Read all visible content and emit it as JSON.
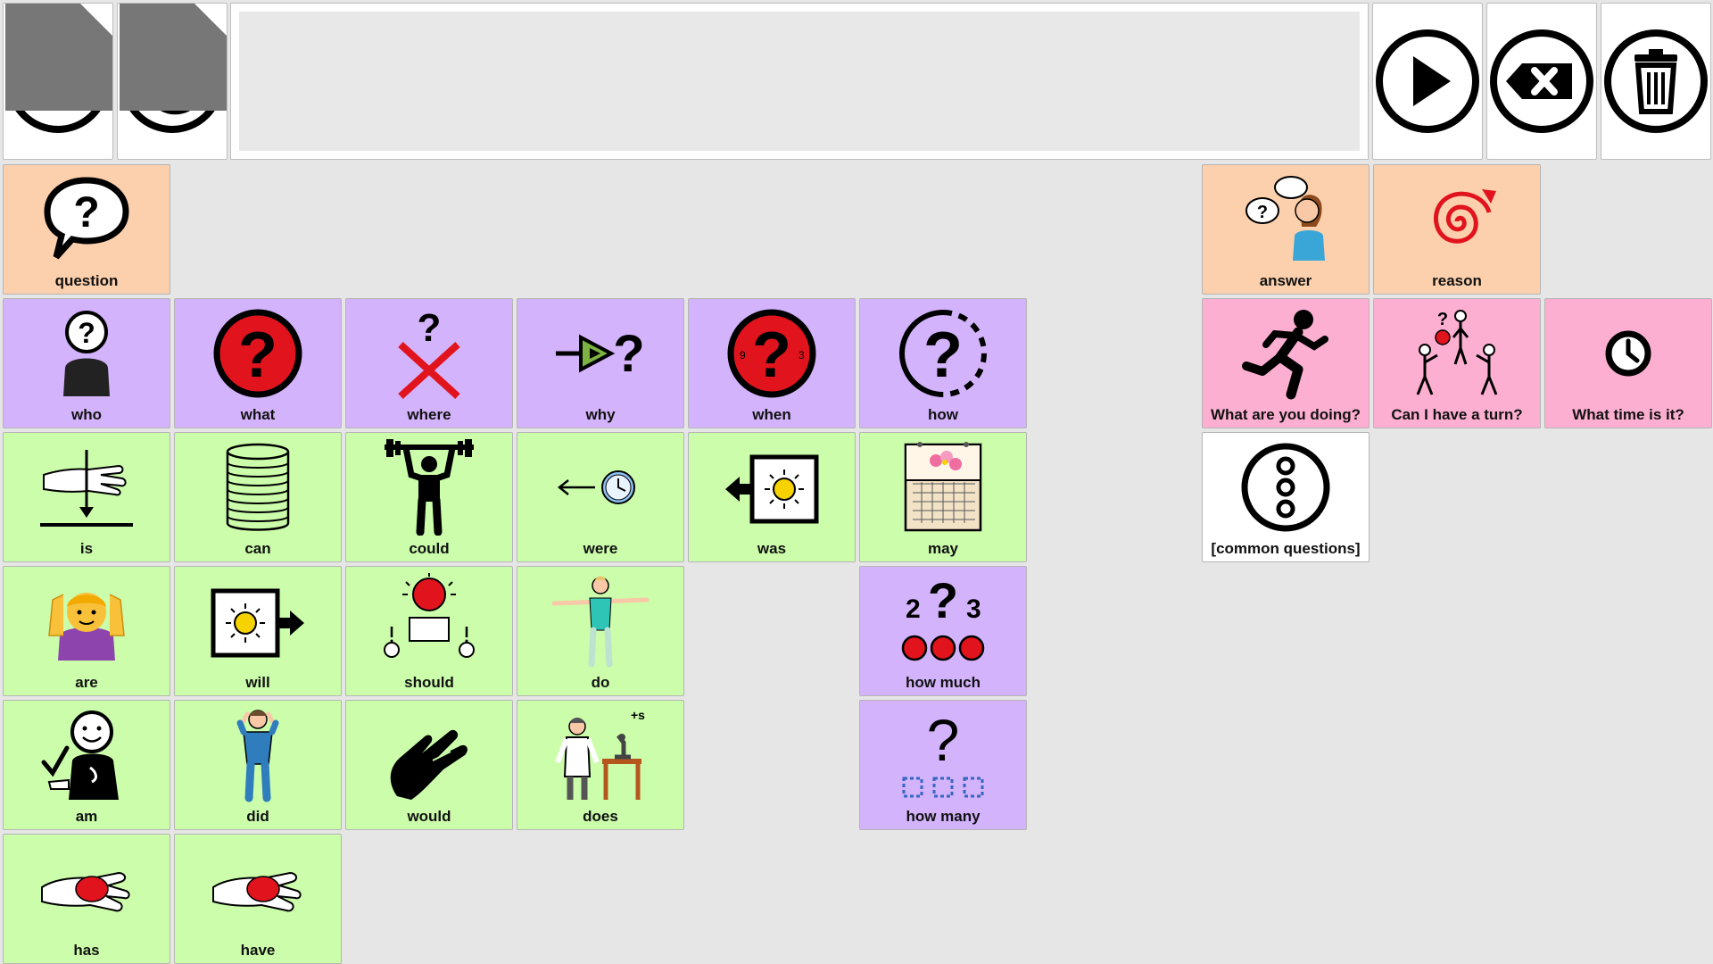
{
  "toolbar": {
    "home": {
      "icon": "home-icon"
    },
    "back": {
      "icon": "undo-icon"
    },
    "speak": {
      "icon": "play-icon"
    },
    "backspace": {
      "icon": "backspace-icon"
    },
    "clear": {
      "icon": "trash-icon"
    }
  },
  "message_bar": {
    "text": ""
  },
  "colors": {
    "orange": "#fcd0ad",
    "purple": "#d3b3fb",
    "green": "#cbfdab",
    "pink": "#fdafd2",
    "white": "#ffffff",
    "red": "#e1141e"
  },
  "cells": [
    {
      "label": "question",
      "icon": "speech-bubble-question-icon"
    },
    {
      "label": "answer",
      "icon": "person-answer-icon"
    },
    {
      "label": "reason",
      "icon": "spiral-icon"
    },
    {
      "label": "who",
      "icon": "person-question-icon"
    },
    {
      "label": "what",
      "icon": "red-question-icon"
    },
    {
      "label": "where",
      "icon": "question-cross-icon"
    },
    {
      "label": "why",
      "icon": "arrow-question-icon"
    },
    {
      "label": "when",
      "icon": "clock-question-icon"
    },
    {
      "label": "how",
      "icon": "dashed-question-icon"
    },
    {
      "label": "What are you doing?",
      "icon": "running-person-icon"
    },
    {
      "label": "Can I have a turn?",
      "icon": "people-ball-icon"
    },
    {
      "label": "What time is it?",
      "icon": "clock-icon"
    },
    {
      "label": "is",
      "icon": "hand-point-down-icon"
    },
    {
      "label": "can",
      "icon": "can-icon"
    },
    {
      "label": "could",
      "icon": "weightlifter-icon"
    },
    {
      "label": "were",
      "icon": "arrow-clock-icon"
    },
    {
      "label": "was",
      "icon": "past-sun-icon"
    },
    {
      "label": "may",
      "icon": "calendar-icon"
    },
    {
      "label": "[common questions]",
      "icon": "more-icon"
    },
    {
      "label": "are",
      "icon": "woman-emoji-icon"
    },
    {
      "label": "will",
      "icon": "future-sun-icon"
    },
    {
      "label": "should",
      "icon": "choice-icon"
    },
    {
      "label": "do",
      "icon": "gymnast-icon"
    },
    {
      "label": "how much",
      "icon": "count-dots-icon"
    },
    {
      "label": "am",
      "icon": "person-self-icon"
    },
    {
      "label": "did",
      "icon": "person-standing-icon"
    },
    {
      "label": "would",
      "icon": "open-hand-icon"
    },
    {
      "label": "does",
      "icon": "scientist-icon"
    },
    {
      "label": "how many",
      "icon": "count-squares-icon"
    },
    {
      "label": "has",
      "icon": "hand-holding-ball-icon"
    },
    {
      "label": "have",
      "icon": "hand-holding-ball-icon"
    }
  ]
}
